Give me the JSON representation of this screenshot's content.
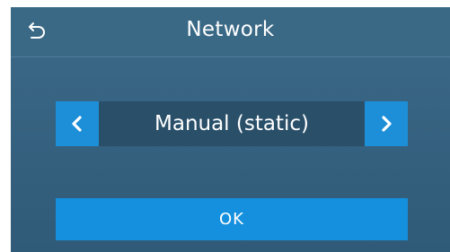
{
  "header": {
    "title": "Network",
    "back_icon": "back-arrow-icon"
  },
  "selector": {
    "value": "Manual (static)",
    "prev_icon": "chevron-left-icon",
    "next_icon": "chevron-right-icon"
  },
  "actions": {
    "ok_label": "OK"
  },
  "colors": {
    "background": "#2f5a78",
    "header": "#3a6986",
    "accent": "#1d8fd8",
    "value_box": "#294f69",
    "text": "#ffffff"
  }
}
